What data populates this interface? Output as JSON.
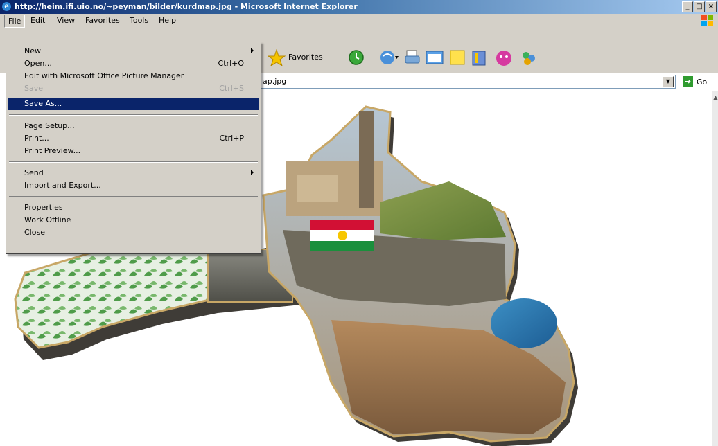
{
  "window": {
    "title": "http://heim.ifi.uio.no/~peyman/bilder/kurdmap.jpg - Microsoft Internet Explorer",
    "min_label": "_",
    "max_label": "□",
    "close_label": "×"
  },
  "menubar": {
    "items": [
      "File",
      "Edit",
      "View",
      "Favorites",
      "Tools",
      "Help"
    ]
  },
  "toolbar": {
    "favorites_label": "Favorites"
  },
  "address": {
    "value": "ap.jpg",
    "go_label": "Go"
  },
  "file_menu": {
    "items": [
      {
        "label": "New",
        "shortcut": "",
        "submenu": true,
        "disabled": false,
        "selected": false
      },
      {
        "label": "Open...",
        "shortcut": "Ctrl+O",
        "submenu": false,
        "disabled": false,
        "selected": false
      },
      {
        "label": "Edit with Microsoft Office Picture Manager",
        "shortcut": "",
        "submenu": false,
        "disabled": false,
        "selected": false
      },
      {
        "label": "Save",
        "shortcut": "Ctrl+S",
        "submenu": false,
        "disabled": true,
        "selected": false
      },
      {
        "label": "Save As...",
        "shortcut": "",
        "submenu": false,
        "disabled": false,
        "selected": true
      },
      {
        "label": "Page Setup...",
        "shortcut": "",
        "submenu": false,
        "disabled": false,
        "selected": false
      },
      {
        "label": "Print...",
        "shortcut": "Ctrl+P",
        "submenu": false,
        "disabled": false,
        "selected": false
      },
      {
        "label": "Print Preview...",
        "shortcut": "",
        "submenu": false,
        "disabled": false,
        "selected": false
      },
      {
        "label": "Send",
        "shortcut": "",
        "submenu": true,
        "disabled": false,
        "selected": false
      },
      {
        "label": "Import and Export...",
        "shortcut": "",
        "submenu": false,
        "disabled": false,
        "selected": false
      },
      {
        "label": "Properties",
        "shortcut": "",
        "submenu": false,
        "disabled": false,
        "selected": false
      },
      {
        "label": "Work Offline",
        "shortcut": "",
        "submenu": false,
        "disabled": false,
        "selected": false
      },
      {
        "label": "Close",
        "shortcut": "",
        "submenu": false,
        "disabled": false,
        "selected": false
      }
    ]
  },
  "colors": {
    "titlebar": "#0a246a",
    "menu_bg": "#d4d0c8",
    "selection": "#0a246a",
    "flag_red": "#d21034",
    "flag_green": "#1a8f3c",
    "flag_sun": "#f7c600"
  }
}
